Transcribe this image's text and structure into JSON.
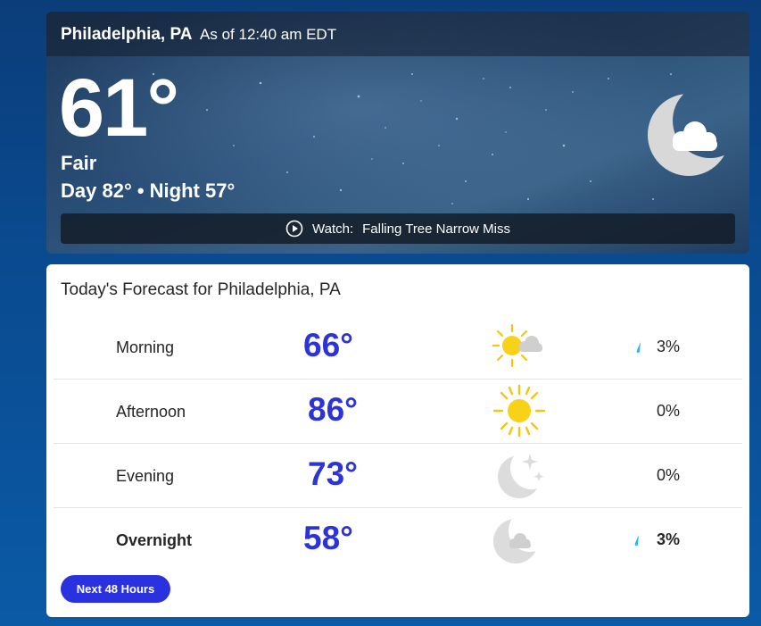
{
  "header": {
    "location": "Philadelphia, PA",
    "as_of": "As of 12:40 am EDT"
  },
  "current": {
    "temperature": "61°",
    "phrase": "Fair",
    "day_night": "Day 82° • Night 57°",
    "icon": "moon-cloud-icon"
  },
  "watch": {
    "prefix": "Watch:",
    "title": "Falling Tree Narrow Miss",
    "icon": "play-circle-icon"
  },
  "forecast": {
    "title": "Today's Forecast for Philadelphia, PA",
    "rows": [
      {
        "label": "Morning",
        "temp": "66°",
        "icon": "sun-cloud-icon",
        "precip": "3%",
        "drop": true
      },
      {
        "label": "Afternoon",
        "temp": "86°",
        "icon": "sun-icon",
        "precip": "0%",
        "drop": false
      },
      {
        "label": "Evening",
        "temp": "73°",
        "icon": "moon-stars-icon",
        "precip": "0%",
        "drop": false
      },
      {
        "label": "Overnight",
        "temp": "58°",
        "icon": "moon-cloud-icon",
        "precip": "3%",
        "drop": true
      }
    ],
    "next_button": "Next 48 Hours"
  },
  "colors": {
    "accent": "#2a32e0",
    "temp_text": "#2c34d8",
    "drop": "#29b6e8"
  }
}
